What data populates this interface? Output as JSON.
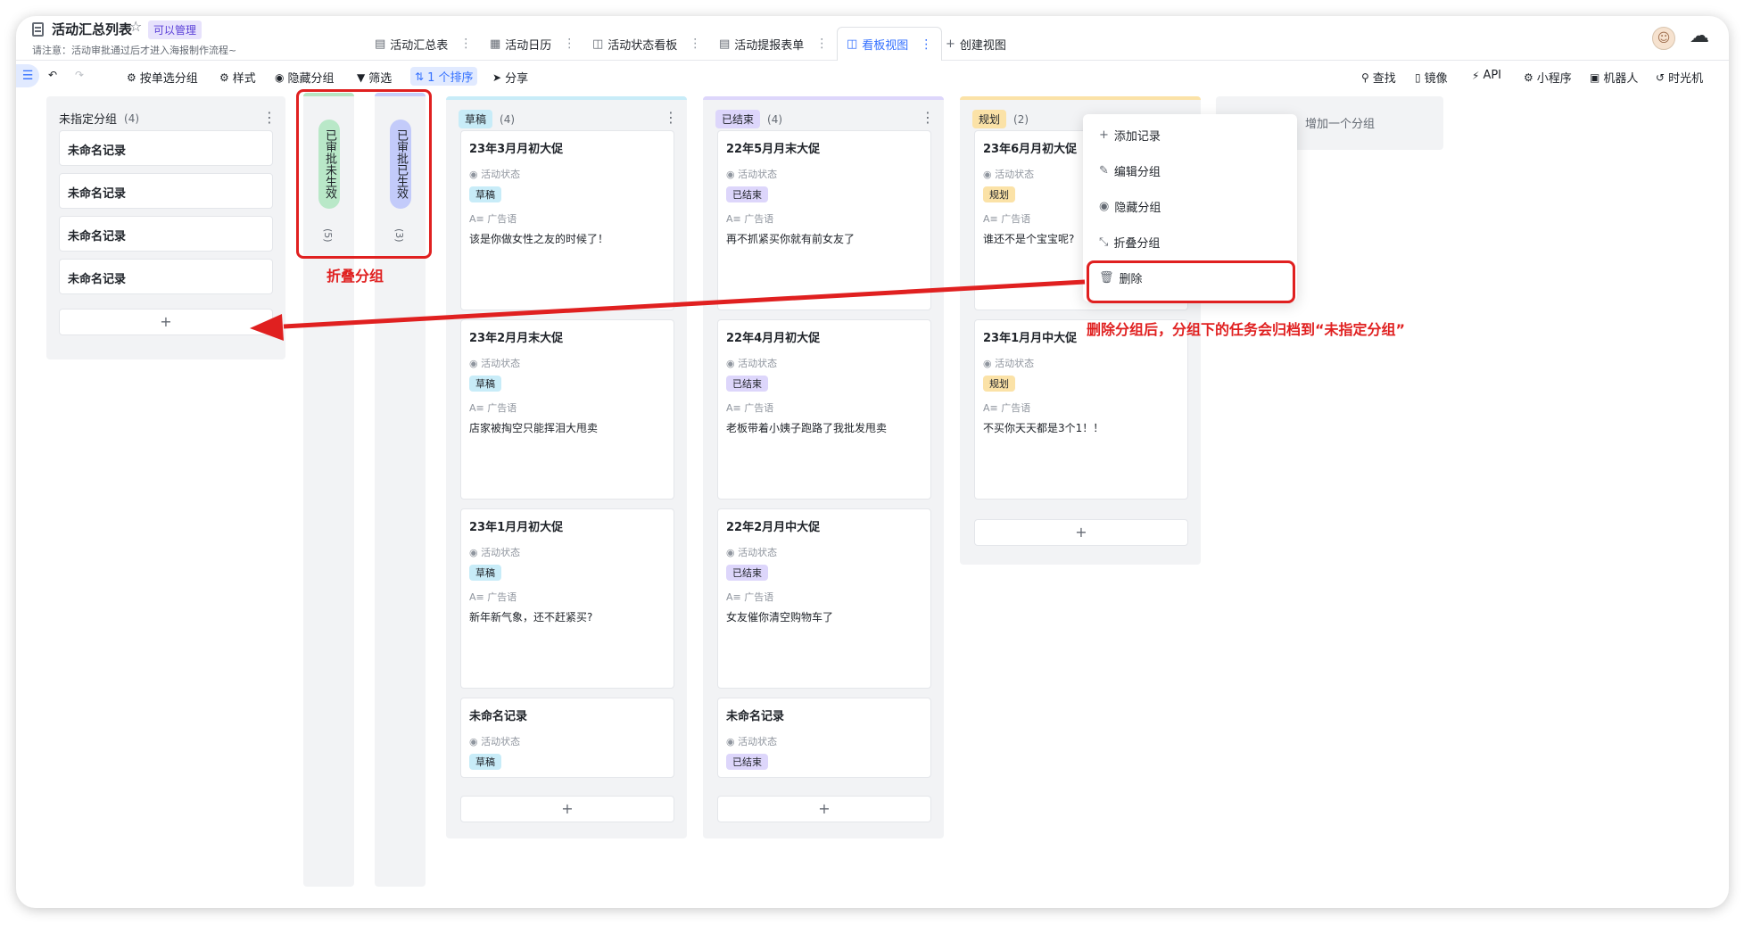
{
  "header": {
    "title": "活动汇总列表",
    "permission": "可以管理",
    "notice": "请注意：活动审批通过后才进入海报制作流程~",
    "tabs": [
      {
        "label": "活动汇总表",
        "icon": "grid-icon"
      },
      {
        "label": "活动日历",
        "icon": "calendar-icon"
      },
      {
        "label": "活动状态看板",
        "icon": "kanban-icon"
      },
      {
        "label": "活动提报表单",
        "icon": "form-icon"
      },
      {
        "label": "看板视图",
        "icon": "kanban-icon"
      }
    ],
    "create_view": "创建视图"
  },
  "toolbar": {
    "group_by": "按单选分组",
    "style": "样式",
    "hide_group": "隐藏分组",
    "filter": "筛选",
    "sort": "1 个排序",
    "share": "分享",
    "search": "查找",
    "mirror": "镜像",
    "api": "API",
    "miniapp": "小程序",
    "robot": "机器人",
    "timemachine": "时光机"
  },
  "field_labels": {
    "status": "活动状态",
    "slogan": "广告语"
  },
  "colors": {
    "accent": "#3370ff",
    "annotation": "#e02020",
    "draft": "#c8ecf8",
    "ended": "#ddd6fb",
    "plan": "#fbe2a7"
  },
  "columns": {
    "unassigned": {
      "name": "未指定分组",
      "count": "(4)",
      "records": [
        "未命名记录",
        "未命名记录",
        "未命名记录",
        "未命名记录"
      ]
    },
    "folded": [
      {
        "name": "已审批未生效",
        "count": "(5)"
      },
      {
        "name": "已审批已生效",
        "count": "(3)"
      }
    ],
    "draft": {
      "name": "草稿",
      "count": "(4)",
      "cards": [
        {
          "title": "23年3月月初大促",
          "status": "草稿",
          "slogan": "该是你做女性之友的时候了！"
        },
        {
          "title": "23年2月月末大促",
          "status": "草稿",
          "slogan": "店家被掏空只能挥泪大甩卖"
        },
        {
          "title": "23年1月月初大促",
          "status": "草稿",
          "slogan": "新年新气象，还不赶紧买?"
        },
        {
          "title": "未命名记录",
          "status": "草稿",
          "slogan": ""
        }
      ]
    },
    "ended": {
      "name": "已结束",
      "count": "(4)",
      "cards": [
        {
          "title": "22年5月月末大促",
          "status": "已结束",
          "slogan": "再不抓紧买你就有前女友了"
        },
        {
          "title": "22年4月月初大促",
          "status": "已结束",
          "slogan": "老板带着小姨子跑路了我批发甩卖"
        },
        {
          "title": "22年2月月中大促",
          "status": "已结束",
          "slogan": "女友催你清空购物车了"
        },
        {
          "title": "未命名记录",
          "status": "已结束",
          "slogan": ""
        }
      ]
    },
    "plan": {
      "name": "规划",
      "count": "(2)",
      "cards": [
        {
          "title": "23年6月月初大促",
          "status": "规划",
          "slogan": "谁还不是个宝宝呢?"
        },
        {
          "title": "23年1月月中大促",
          "status": "规划",
          "slogan": "不买你天天都是3个1！！"
        }
      ]
    },
    "add_group": "增加一个分组",
    "add_symbol": "+"
  },
  "context_menu": {
    "items": [
      {
        "label": "添加记录",
        "icon": "plus-icon"
      },
      {
        "label": "编辑分组",
        "icon": "edit-icon"
      },
      {
        "label": "隐藏分组",
        "icon": "eye-icon"
      },
      {
        "label": "折叠分组",
        "icon": "collapse-icon"
      },
      {
        "label": "删除",
        "icon": "trash-icon"
      }
    ]
  },
  "annotations": {
    "fold_label": "折叠分组",
    "delete_note": "删除分组后，分组下的任务会归档到“未指定分组”"
  }
}
